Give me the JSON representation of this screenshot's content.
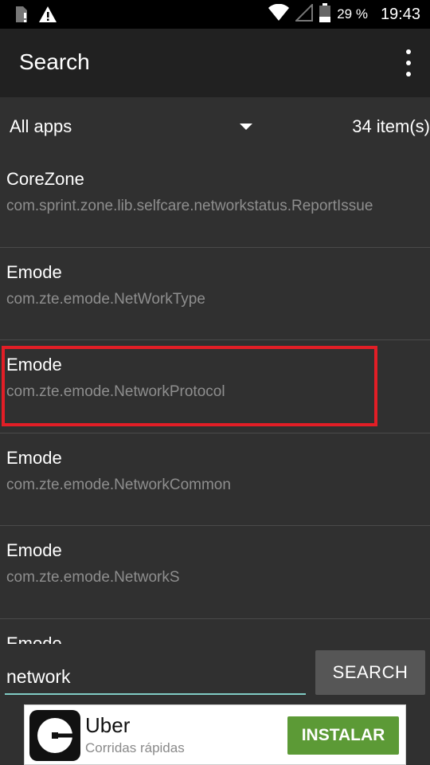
{
  "status_bar": {
    "icons": [
      "sim-alert-icon",
      "warning-icon",
      "wifi-icon",
      "signal-icon",
      "battery-icon"
    ],
    "battery_percent": "29 %",
    "time": "19:43"
  },
  "toolbar": {
    "title": "Search",
    "menu_icon": "overflow-menu-icon"
  },
  "filter": {
    "selected": "All apps",
    "count": "34 item(s)"
  },
  "results": [
    {
      "name": "CoreZone",
      "package": "com.sprint.zone.lib.selfcare.networkstatus.ReportIssue"
    },
    {
      "name": "Emode",
      "package": "com.zte.emode.NetWorkType"
    },
    {
      "name": "Emode",
      "package": "com.zte.emode.NetworkProtocol"
    },
    {
      "name": "Emode",
      "package": "com.zte.emode.NetworkCommon"
    },
    {
      "name": "Emode",
      "package": "com.zte.emode.NetworkS"
    },
    {
      "name": "Emode",
      "package": ""
    }
  ],
  "highlight_color": "#e21e26",
  "search": {
    "value": "network",
    "button_label": "SEARCH"
  },
  "ad": {
    "title": "Uber",
    "subtitle": "Corridas rápidas",
    "button_label": "INSTALAR",
    "button_color": "#5c9a36"
  }
}
